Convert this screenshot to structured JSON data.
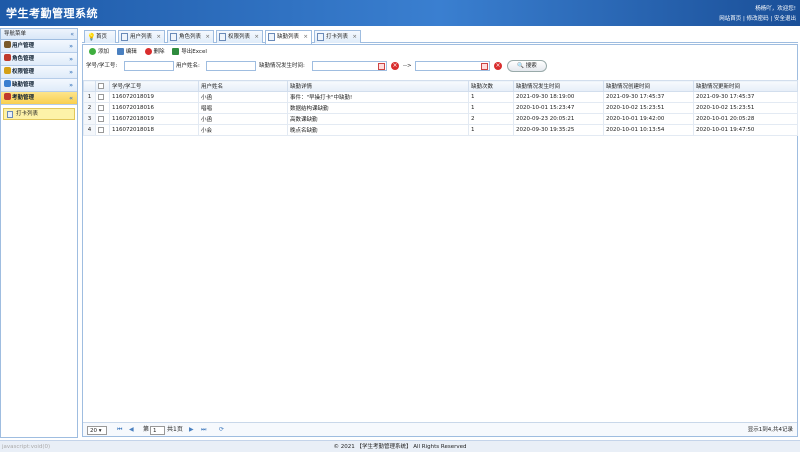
{
  "header": {
    "title": "学生考勤管理系统",
    "welcome": "杨杨吖，欢迎您!",
    "links": [
      "网站首页",
      "修改密码",
      "安全退出"
    ],
    "separator": "|"
  },
  "sidebar": {
    "title": "导航菜单",
    "collapse_icon": "«",
    "menus": [
      {
        "label": "用户管理",
        "chev": "»",
        "color": "#7a5a2a"
      },
      {
        "label": "角色管理",
        "chev": "»",
        "color": "#c0392b"
      },
      {
        "label": "权限管理",
        "chev": "»",
        "color": "#d4a017"
      },
      {
        "label": "缺勤管理",
        "chev": "»",
        "color": "#3a7fd0"
      },
      {
        "label": "考勤管理",
        "chev": "«",
        "color": "#c0392b"
      }
    ],
    "submenu": {
      "label": "打卡列表"
    }
  },
  "tabs": [
    {
      "label": "首页"
    },
    {
      "label": "用户列表"
    },
    {
      "label": "角色列表"
    },
    {
      "label": "权限列表"
    },
    {
      "label": "缺勤列表"
    },
    {
      "label": "打卡列表"
    }
  ],
  "tab_close": "×",
  "toolbar": {
    "add": "添加",
    "edit": "编辑",
    "delete": "删除",
    "export": "导出Excel"
  },
  "search": {
    "id_label": "学号/学工号:",
    "name_label": "用户姓名:",
    "time_label": "缺勤情况发生时间:",
    "arrow": "-->",
    "button": "搜索",
    "clear": "×"
  },
  "table": {
    "headers": [
      "学号/学工号",
      "用户姓名",
      "缺勤详情",
      "缺勤次数",
      "缺勤情况发生时间",
      "缺勤情况创建时间",
      "缺勤情况更新时间"
    ],
    "rows": [
      {
        "n": "1",
        "id": "116072018019",
        "name": "小函",
        "detail": "事件：\"早操打卡\"中缺勤!",
        "count": "1",
        "occur": "2021-09-30 18:19:00",
        "create": "2021-09-30 17:45:37",
        "update": "2021-09-30 17:45:37"
      },
      {
        "n": "2",
        "id": "116072018016",
        "name": "唱唱",
        "detail": "数据结构课缺勤",
        "count": "1",
        "occur": "2020-10-01 15:23:47",
        "create": "2020-10-02 15:23:51",
        "update": "2020-10-02 15:23:51"
      },
      {
        "n": "3",
        "id": "116072018019",
        "name": "小函",
        "detail": "高数课缺勤",
        "count": "2",
        "occur": "2020-09-23 20:05:21",
        "create": "2020-10-01 19:42:00",
        "update": "2020-10-01 20:05:28"
      },
      {
        "n": "4",
        "id": "116072018018",
        "name": "小会",
        "detail": "晚点名缺勤",
        "count": "1",
        "occur": "2020-09-30 19:35:25",
        "create": "2020-10-01 10:13:54",
        "update": "2020-10-01 19:47:50"
      }
    ]
  },
  "pager": {
    "page_size": "20",
    "page_prefix": "第",
    "page_value": "1",
    "page_total": "共1页",
    "info": "显示1到4,共4记录"
  },
  "footer": {
    "status": "javascript:void(0)",
    "copyright": "© 2021 【学生考勤管理系统】 All Rights Reserved"
  }
}
